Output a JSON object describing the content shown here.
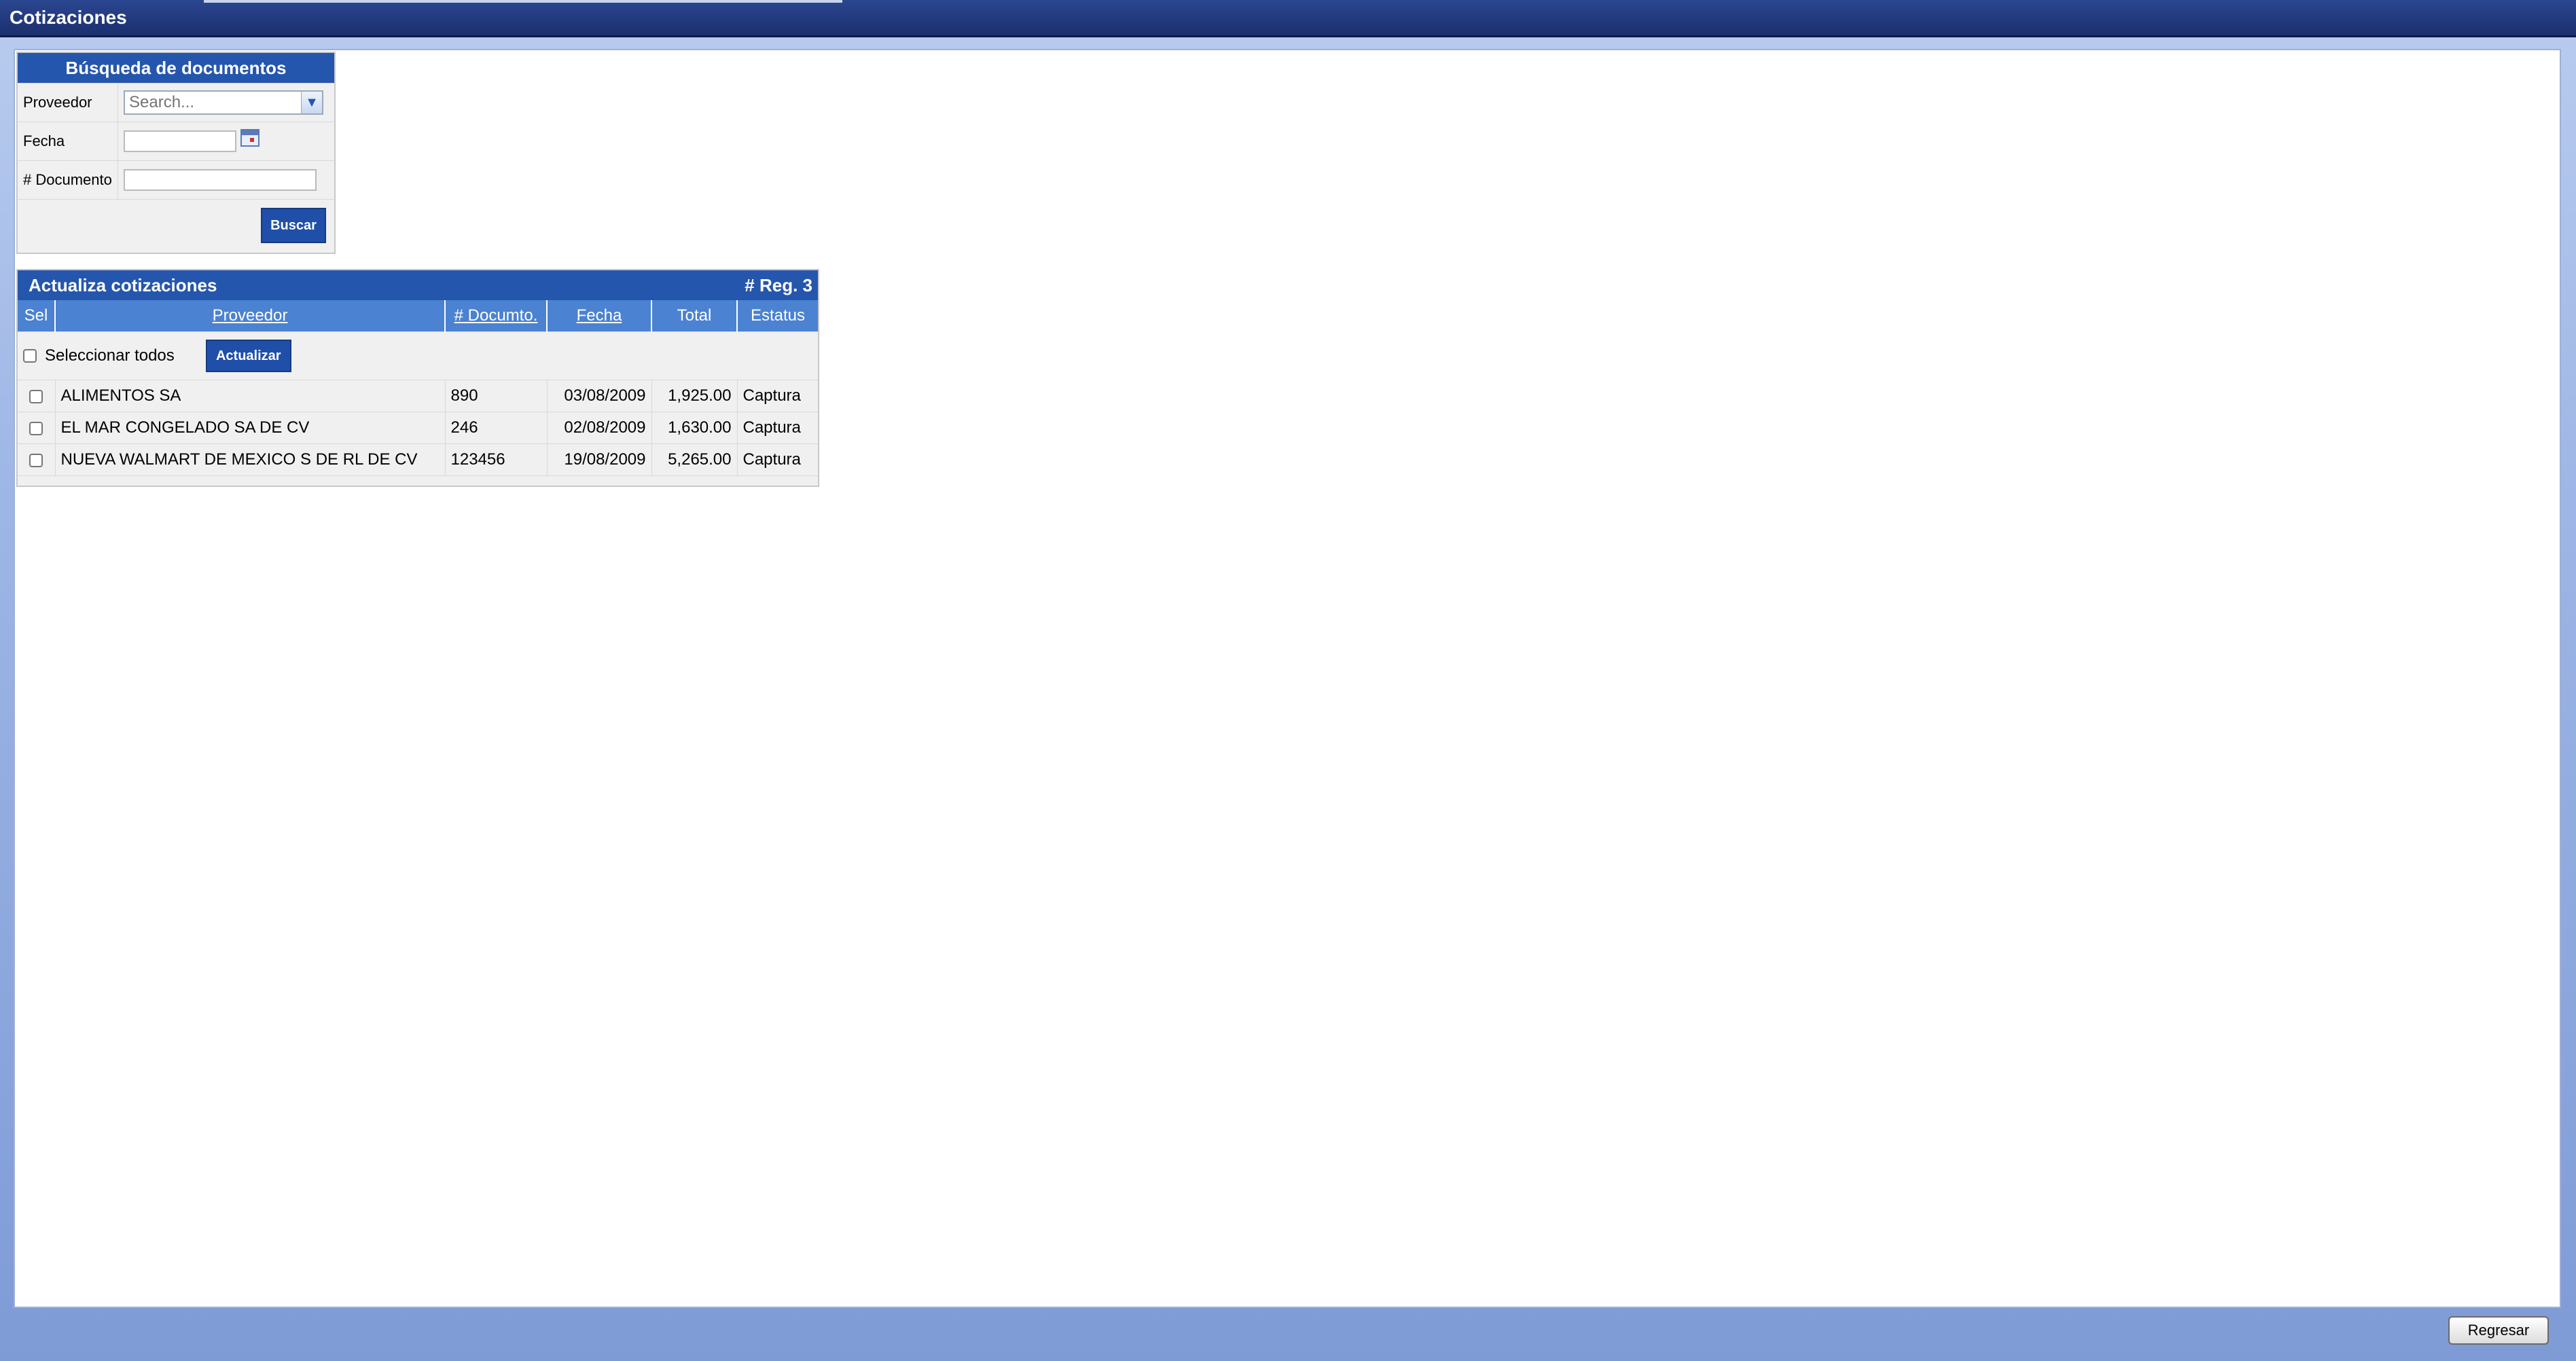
{
  "window": {
    "title": "Cotizaciones"
  },
  "search": {
    "header": "Búsqueda de documentos",
    "proveedor_label": "Proveedor",
    "proveedor_placeholder": "Search...",
    "fecha_label": "Fecha",
    "fecha_value": "",
    "documento_label": "# Documento",
    "documento_value": "",
    "buscar_label": "Buscar"
  },
  "results": {
    "header": "Actualiza cotizaciones",
    "reg_count": "# Reg. 3",
    "columns": [
      "Sel",
      "Proveedor",
      "# Documto.",
      "Fecha",
      "Total",
      "Estatus"
    ],
    "select_all_label": "Seleccionar todos",
    "actualizar_label": "Actualizar",
    "rows": [
      {
        "proveedor": "ALIMENTOS SA",
        "documento": "890",
        "fecha": "03/08/2009",
        "total": "1,925.00",
        "estatus": "Captura"
      },
      {
        "proveedor": "EL MAR CONGELADO SA DE CV",
        "documento": "246",
        "fecha": "02/08/2009",
        "total": "1,630.00",
        "estatus": "Captura"
      },
      {
        "proveedor": "NUEVA WALMART DE MEXICO S DE RL DE CV",
        "documento": "123456",
        "fecha": "19/08/2009",
        "total": "5,265.00",
        "estatus": "Captura"
      }
    ]
  },
  "footer": {
    "regresar_label": "Regresar"
  },
  "icons": {
    "dropdown": "chevron-down-icon",
    "calendar": "calendar-icon"
  },
  "colors": {
    "header_blue": "#2556ad",
    "column_blue": "#4b82d1",
    "titlebar": "#1b2f6e"
  }
}
